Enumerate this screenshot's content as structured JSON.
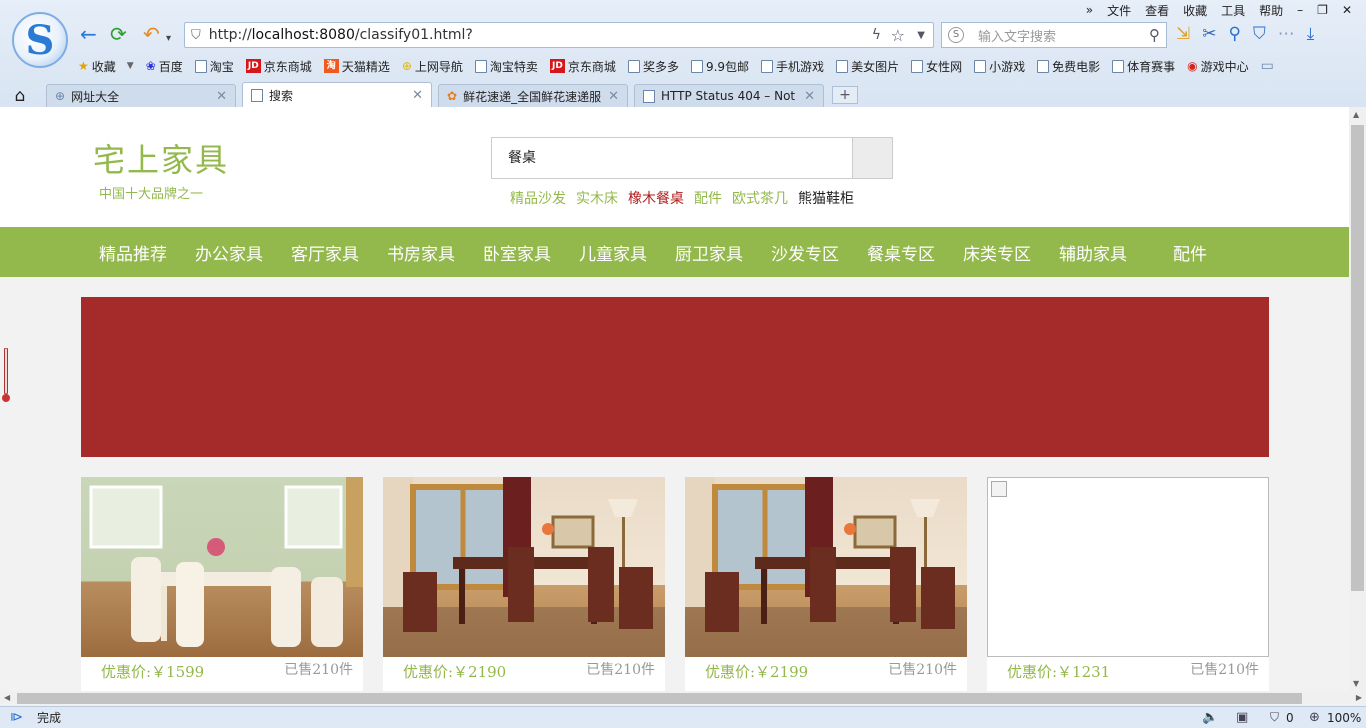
{
  "browser": {
    "menu": [
      "文件",
      "查看",
      "收藏",
      "工具",
      "帮助"
    ],
    "url_prefix": "http://",
    "url_host": "localhost:8080",
    "url_path": "/classify01.html?",
    "search_placeholder": "输入文字搜索",
    "bookmarks": [
      "收藏",
      "百度",
      "淘宝",
      "京东商城",
      "天猫精选",
      "上网导航",
      "淘宝特卖",
      "京东商城",
      "奖多多",
      "9.9包邮",
      "手机游戏",
      "美女图片",
      "女性网",
      "小游戏",
      "免费电影",
      "体育赛事",
      "游戏中心"
    ],
    "tabs": [
      {
        "label": "网址大全"
      },
      {
        "label": "搜索"
      },
      {
        "label": "鲜花速递_全国鲜花速递服"
      },
      {
        "label": "HTTP Status 404 – Not"
      }
    ],
    "status_text": "完成",
    "shield_count": "0",
    "zoom": "100%"
  },
  "site": {
    "logo_title": "宅上家具",
    "logo_slogan": "中国十大品牌之一",
    "search_value": "餐桌",
    "hot_words": [
      "精品沙发",
      "实木床",
      "橡木餐桌",
      "配件",
      "欧式茶几",
      "熊猫鞋柜"
    ],
    "nav": [
      "精品推荐",
      "办公家具",
      "客厅家具",
      "书房家具",
      "卧室家具",
      "儿童家具",
      "厨卫家具",
      "沙发专区",
      "餐桌专区",
      "床类专区",
      "辅助家具",
      "配件"
    ],
    "banner_color": "#a52a2a",
    "accent": "#93b84b",
    "products": [
      {
        "price": "优惠价:￥1599",
        "sold": "已售210件"
      },
      {
        "price": "优惠价:￥2190",
        "sold": "已售210件"
      },
      {
        "price": "优惠价:￥2199",
        "sold": "已售210件"
      },
      {
        "price": "优惠价:￥1231",
        "sold": "已售210件"
      }
    ]
  }
}
